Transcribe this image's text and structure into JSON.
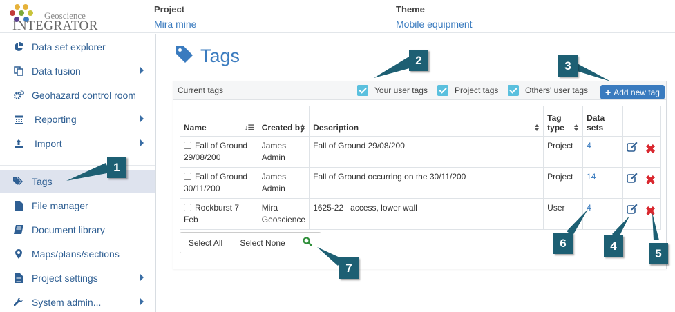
{
  "header": {
    "logo": {
      "sub": "Geoscience",
      "main": "INTEGRATOR"
    },
    "project_label": "Project",
    "project_value": "Mira mine",
    "theme_label": "Theme",
    "theme_value": "Mobile equipment"
  },
  "sidebar": {
    "items": [
      {
        "label": "Data set explorer",
        "icon": "pie-chart-icon"
      },
      {
        "label": "Data fusion",
        "icon": "copy-icon"
      },
      {
        "label": "Geohazard control room",
        "icon": "gears-icon"
      },
      {
        "label": "Reporting",
        "icon": "calendar-icon"
      },
      {
        "label": "Import",
        "icon": "upload-icon"
      },
      {
        "label": "Tags",
        "icon": "tags-icon"
      },
      {
        "label": "File manager",
        "icon": "file-icon"
      },
      {
        "label": "Document library",
        "icon": "book-icon"
      },
      {
        "label": "Maps/plans/sections",
        "icon": "map-marker-icon"
      },
      {
        "label": "Project settings",
        "icon": "file-text-icon"
      },
      {
        "label": "System admin...",
        "icon": "wrench-icon"
      }
    ]
  },
  "page": {
    "title": "Tags",
    "current_tags_label": "Current tags",
    "filters": {
      "your_user_tags": "Your user tags",
      "project_tags": "Project tags",
      "others_user_tags": "Others' user tags"
    },
    "add_new_tag": "Add new tag"
  },
  "table": {
    "headers": {
      "name": "Name",
      "created_by_1": "Created by",
      "description": "Description",
      "tag_type": "Tag type",
      "data_sets_1": "Data",
      "data_sets_2": "sets"
    },
    "rows": [
      {
        "name_1": "Fall of Ground",
        "name_2": "29/08/200",
        "created_1": "James",
        "created_2": "Admin",
        "description": "Fall of Ground 29/08/200",
        "tag_type": "Project",
        "data_sets": "4"
      },
      {
        "name_1": "Fall of Ground",
        "name_2": "30/11/200",
        "created_1": "James",
        "created_2": "Admin",
        "description": "Fall of Ground occurring on the 30/11/200",
        "tag_type": "Project",
        "data_sets": "14"
      },
      {
        "name_1": "Rockburst 7 Feb",
        "name_2": "",
        "created_1": "Mira",
        "created_2": "Geoscience",
        "description": "1625-22   access, lower wall",
        "tag_type": "User",
        "data_sets": "4"
      }
    ]
  },
  "buttons": {
    "select_all": "Select All",
    "select_none": "Select None"
  },
  "callouts": [
    "1",
    "2",
    "3",
    "4",
    "5",
    "6",
    "7"
  ],
  "colors": {
    "accent": "#3a7bbf",
    "callout": "#1d5f73",
    "delete": "#d9282f",
    "checkbox": "#5bc0de"
  }
}
